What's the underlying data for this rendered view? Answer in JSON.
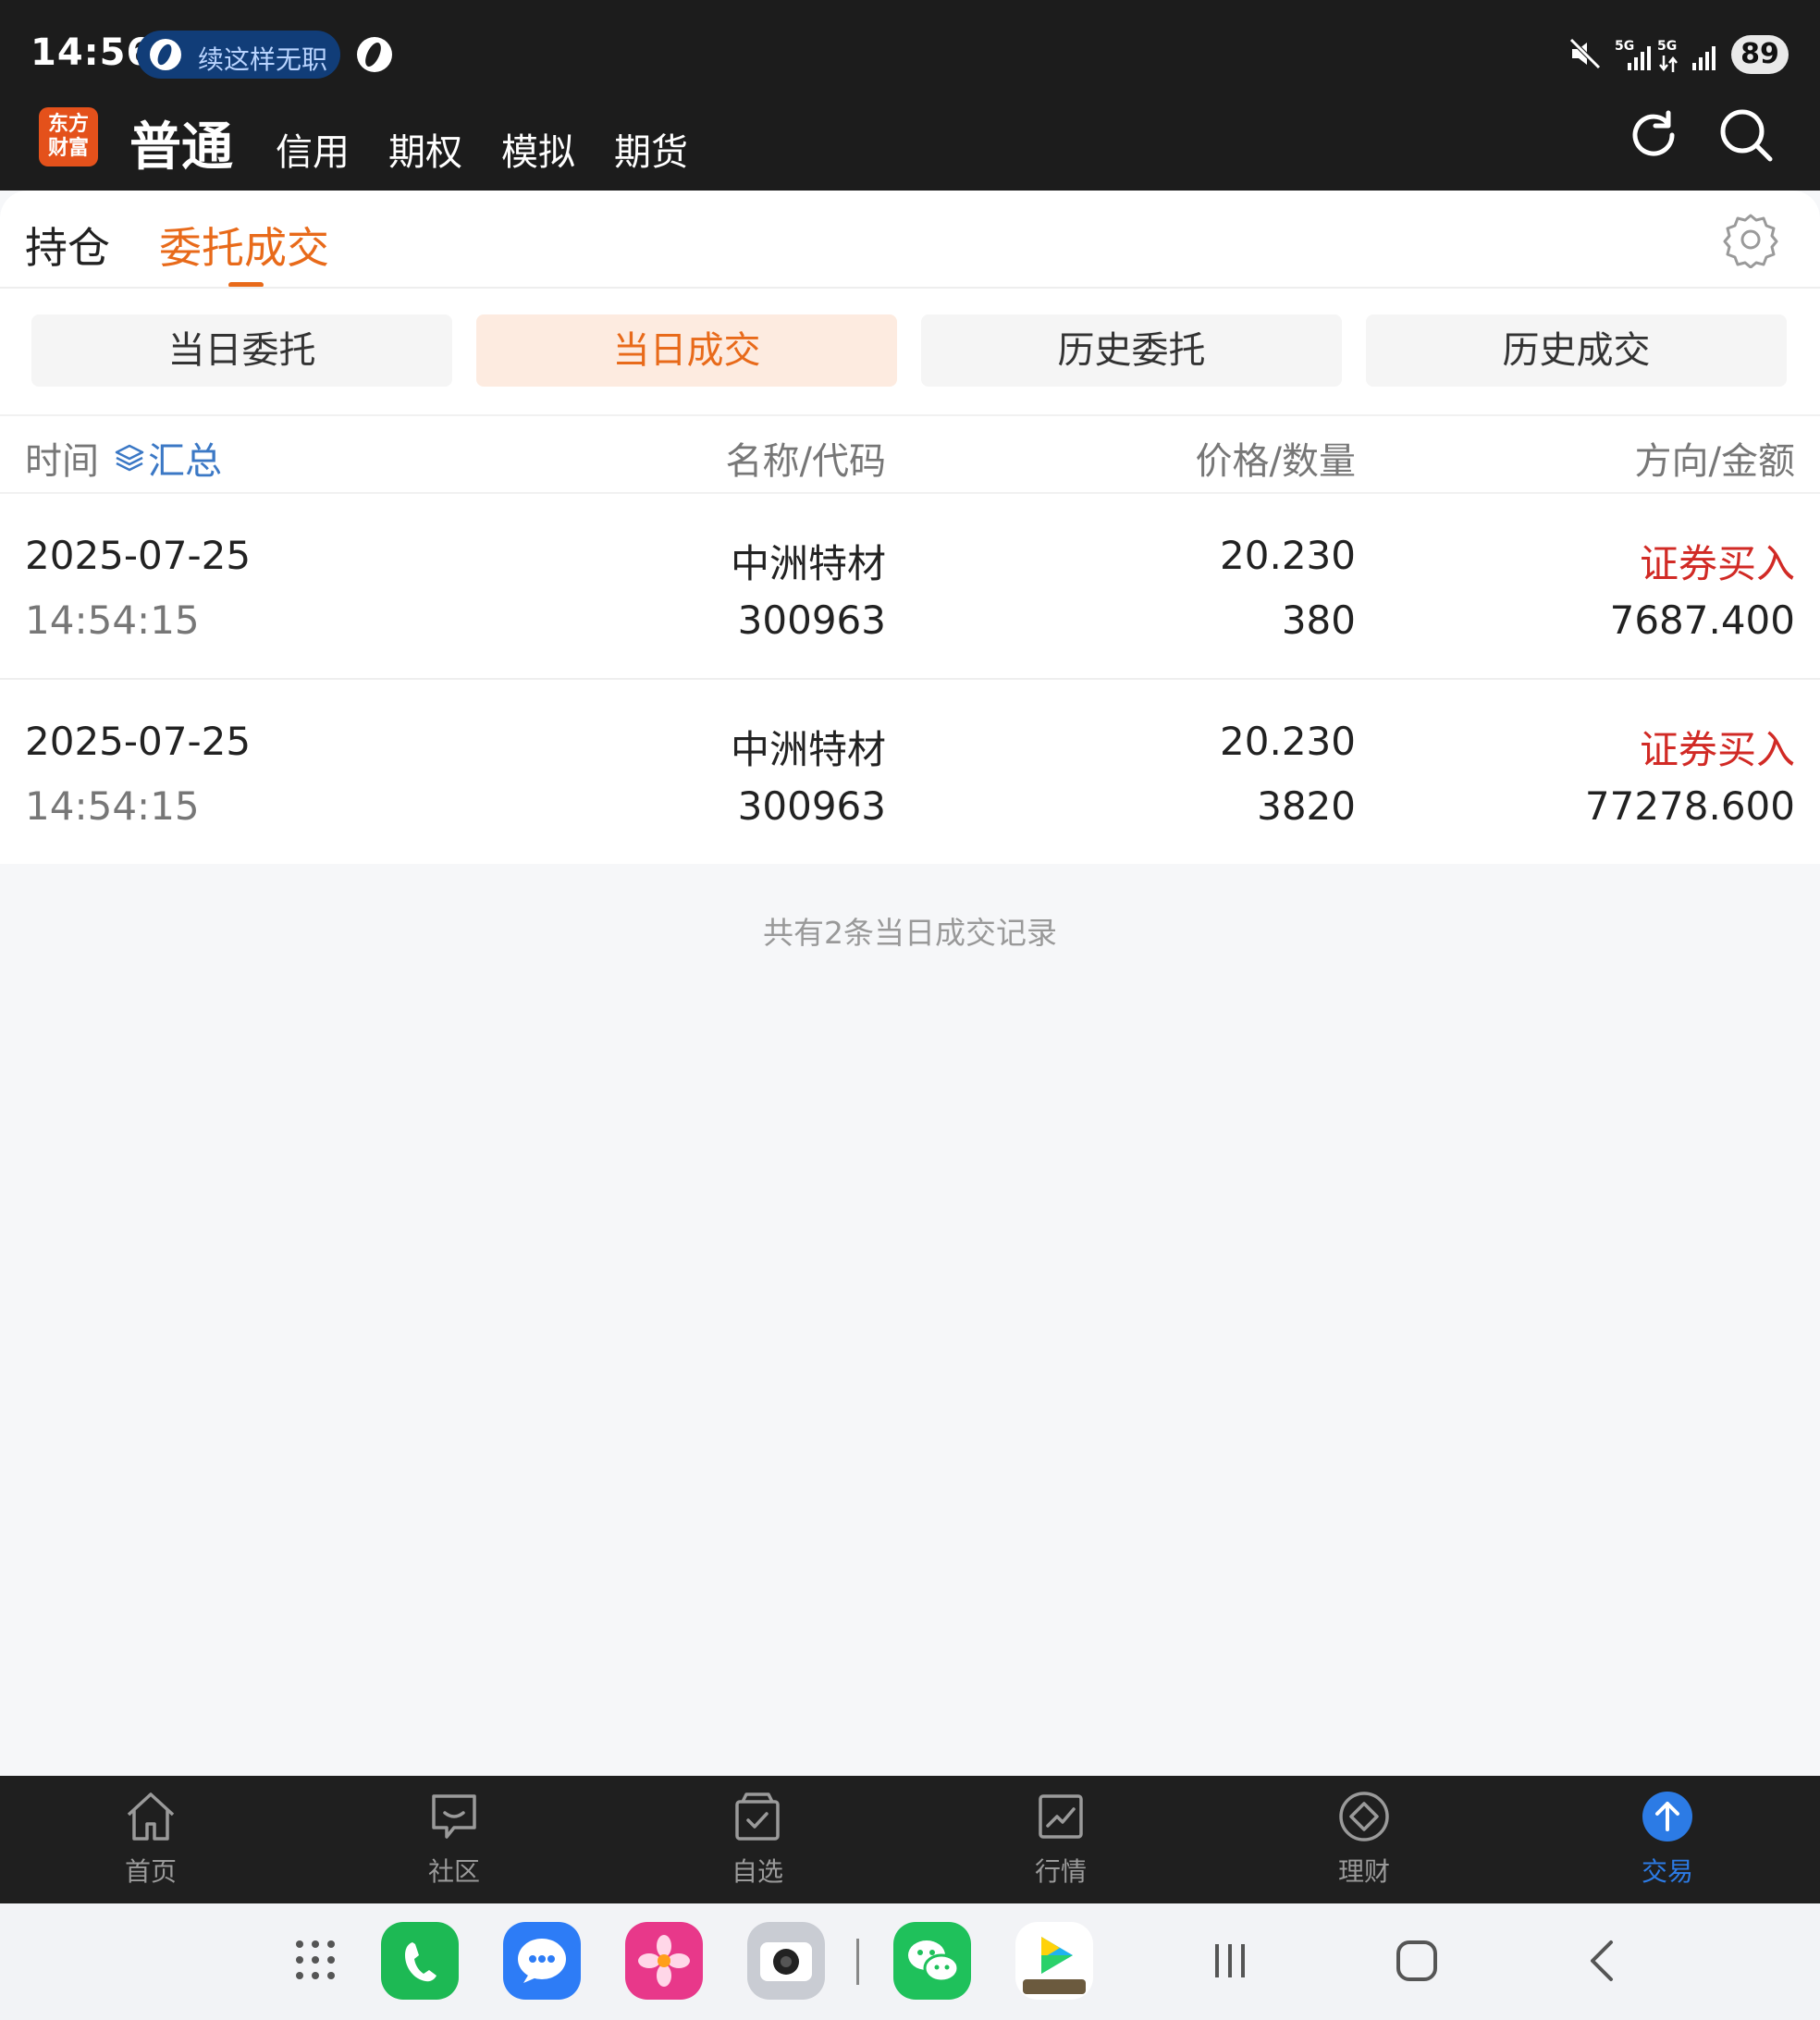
{
  "status_bar": {
    "time": "14:56",
    "notification_text": "续这样无职",
    "net1": "5G",
    "net2": "5G",
    "battery": "89"
  },
  "app_header": {
    "logo_text": [
      "东方",
      "财富"
    ],
    "accounts": [
      "普通",
      "信用",
      "期权",
      "模拟",
      "期货"
    ],
    "active_account": "普通"
  },
  "top_tabs": {
    "items": [
      "持仓",
      "委托成交"
    ],
    "active": "委托成交"
  },
  "segments": {
    "items": [
      "当日委托",
      "当日成交",
      "历史委托",
      "历史成交"
    ],
    "active": "当日成交"
  },
  "table": {
    "headers": {
      "time": "时间",
      "summary": "汇总",
      "name_code": "名称/代码",
      "price_qty": "价格/数量",
      "side_amount": "方向/金额"
    },
    "rows": [
      {
        "date": "2025-07-25",
        "time": "14:54:15",
        "name": "中洲特材",
        "code": "300963",
        "price": "20.230",
        "qty": "380",
        "side": "证券买入",
        "amount": "7687.400"
      },
      {
        "date": "2025-07-25",
        "time": "14:54:15",
        "name": "中洲特材",
        "code": "300963",
        "price": "20.230",
        "qty": "3820",
        "side": "证券买入",
        "amount": "77278.600"
      }
    ]
  },
  "footer_note": "共有2条当日成交记录",
  "bottom_nav": {
    "items": [
      "首页",
      "社区",
      "自选",
      "行情",
      "理财",
      "交易"
    ],
    "active": "交易"
  },
  "colors": {
    "accent_orange": "#e86a1a",
    "buy_red": "#d12a25",
    "link_blue": "#3b78c5",
    "nav_active_blue": "#2c7be5"
  }
}
